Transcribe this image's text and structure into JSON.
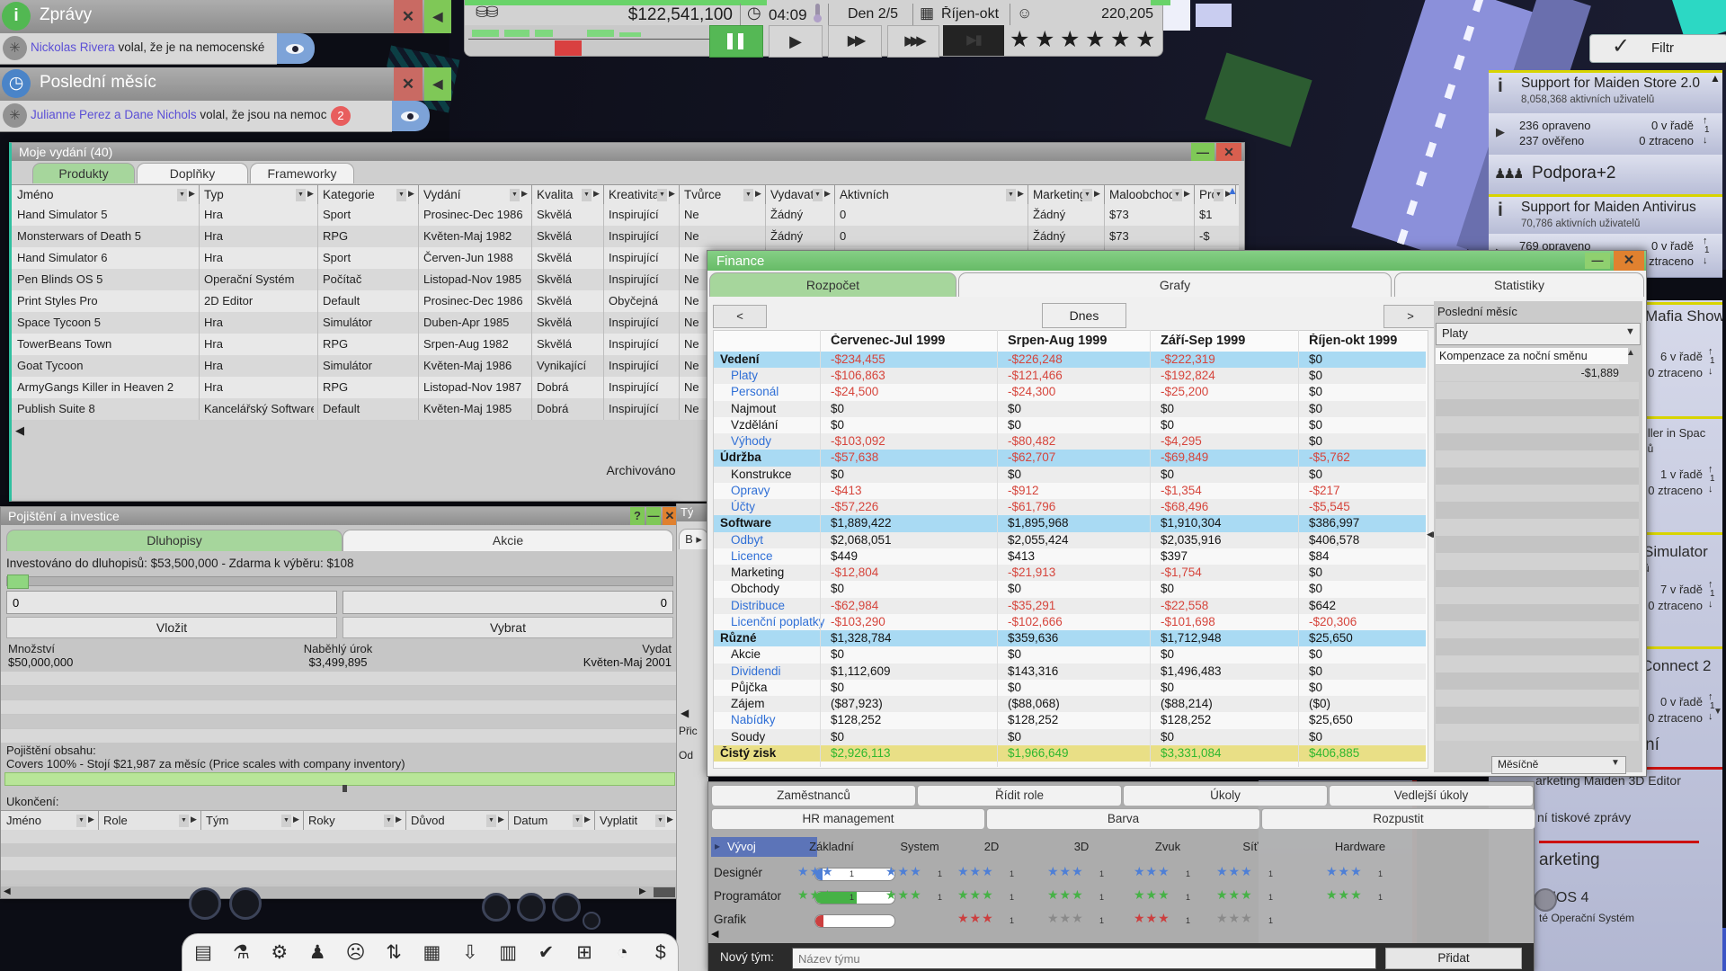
{
  "hud": {
    "money": "$122,541,100",
    "time": "04:09",
    "day": "Den 2/5",
    "month": "Říjen-okt",
    "fans": "220,205",
    "stars": 6,
    "accent_green": "#55b855",
    "accent_red": "#d94040"
  },
  "news": {
    "title": "Zprávy",
    "person": "Nickolas Rivera",
    "message": " volal, že je na nemocenské"
  },
  "last_month_popup": {
    "title": "Poslední měsíc",
    "persons": "Julianne Perez a Dane Nichols",
    "message": " volal, že jsou na nemocenské",
    "badge": "2"
  },
  "releases": {
    "title": "Moje vydání (40)",
    "tabs": [
      "Produkty",
      "Doplňky",
      "Frameworky"
    ],
    "active_tab": 0,
    "columns": [
      "Jméno",
      "Typ",
      "Kategorie",
      "Vydání",
      "Kvalita",
      "Kreativita",
      "Tvůrce",
      "Vydavatel",
      "Aktivních",
      "Marketing",
      "Maloobchod",
      "Pro"
    ],
    "rows": [
      [
        "Hand Simulator 5",
        "Hra",
        "Sport",
        "Prosinec-Dec 1986",
        "Skvělá",
        "Inspirující",
        "Ne",
        "Žádný",
        "0",
        "Žádný",
        "$73",
        "$1"
      ],
      [
        "Monsterwars of Death 5",
        "Hra",
        "RPG",
        "Květen-Maj 1982",
        "Skvělá",
        "Inspirující",
        "Ne",
        "Žádný",
        "0",
        "Žádný",
        "$73",
        "-$"
      ],
      [
        "Hand Simulator 6",
        "Hra",
        "Sport",
        "Červen-Jun 1988",
        "Skvělá",
        "Inspirující",
        "Ne",
        "",
        "",
        "",
        "",
        ""
      ],
      [
        "Pen Blinds OS 5",
        "Operační Systém",
        "Počítač",
        "Listopad-Nov 1985",
        "Skvělá",
        "Inspirující",
        "Ne",
        "",
        "",
        "",
        "",
        ""
      ],
      [
        "Print Styles Pro",
        "2D Editor",
        "Default",
        "Prosinec-Dec 1986",
        "Skvělá",
        "Obyčejná",
        "Ne",
        "",
        "",
        "",
        "",
        ""
      ],
      [
        "Space Tycoon 5",
        "Hra",
        "Simulátor",
        "Duben-Apr 1985",
        "Skvělá",
        "Inspirující",
        "Ne",
        "",
        "",
        "",
        "",
        ""
      ],
      [
        "TowerBeans Town",
        "Hra",
        "RPG",
        "Srpen-Aug 1982",
        "Skvělá",
        "Inspirující",
        "Ne",
        "",
        "",
        "",
        "",
        ""
      ],
      [
        "Goat Tycoon",
        "Hra",
        "Simulátor",
        "Květen-Maj 1986",
        "Vynikající",
        "Inspirující",
        "Ne",
        "",
        "",
        "",
        "",
        ""
      ],
      [
        "ArmyGangs Killer in Heaven 2",
        "Hra",
        "RPG",
        "Listopad-Nov 1987",
        "Dobrá",
        "Inspirující",
        "Ne",
        "",
        "",
        "",
        "",
        ""
      ],
      [
        "Publish Suite 8",
        "Kancelářský Software",
        "Default",
        "Květen-Maj 1985",
        "Dobrá",
        "Inspirující",
        "Ne",
        "",
        "",
        "",
        "",
        ""
      ]
    ],
    "footer": "Archivováno"
  },
  "finance": {
    "title": "Finance",
    "tabs": [
      "Rozpočet",
      "Grafy",
      "Statistiky"
    ],
    "active_tab": 0,
    "prev": "<",
    "today": "Dnes",
    "next": ">",
    "months": [
      "Červenec-Jul 1999",
      "Srpen-Aug 1999",
      "Září-Sep 1999",
      "Říjen-okt 1999"
    ],
    "rows": [
      [
        "Vedení",
        "-$234,455",
        "-$226,248",
        "-$222,319",
        "$0",
        "section"
      ],
      [
        "Platy",
        "-$106,863",
        "-$121,466",
        "-$192,824",
        "$0",
        "link"
      ],
      [
        "Personál",
        "-$24,500",
        "-$24,300",
        "-$25,200",
        "$0",
        "link"
      ],
      [
        "Najmout",
        "$0",
        "$0",
        "$0",
        "$0",
        "plain"
      ],
      [
        "Vzdělání",
        "$0",
        "$0",
        "$0",
        "$0",
        "plain"
      ],
      [
        "Výhody",
        "-$103,092",
        "-$80,482",
        "-$4,295",
        "$0",
        "link"
      ],
      [
        "Údržba",
        "-$57,638",
        "-$62,707",
        "-$69,849",
        "-$5,762",
        "section"
      ],
      [
        "Konstrukce",
        "$0",
        "$0",
        "$0",
        "$0",
        "plain"
      ],
      [
        "Opravy",
        "-$413",
        "-$912",
        "-$1,354",
        "-$217",
        "link"
      ],
      [
        "Účty",
        "-$57,226",
        "-$61,796",
        "-$68,496",
        "-$5,545",
        "link"
      ],
      [
        "Software",
        "$1,889,422",
        "$1,895,968",
        "$1,910,304",
        "$386,997",
        "section"
      ],
      [
        "Odbyt",
        "$2,068,051",
        "$2,055,424",
        "$2,035,916",
        "$406,578",
        "link"
      ],
      [
        "Licence",
        "$449",
        "$413",
        "$397",
        "$84",
        "link"
      ],
      [
        "Marketing",
        "-$12,804",
        "-$21,913",
        "-$1,754",
        "$0",
        "plain"
      ],
      [
        "Obchody",
        "$0",
        "$0",
        "$0",
        "$0",
        "plain"
      ],
      [
        "Distribuce",
        "-$62,984",
        "-$35,291",
        "-$22,558",
        "$642",
        "link"
      ],
      [
        "Licenční poplatky",
        "-$103,290",
        "-$102,666",
        "-$101,698",
        "-$20,306",
        "link"
      ],
      [
        "Různé",
        "$1,328,784",
        "$359,636",
        "$1,712,948",
        "$25,650",
        "section"
      ],
      [
        "Akcie",
        "$0",
        "$0",
        "$0",
        "$0",
        "plain"
      ],
      [
        "Dividendi",
        "$1,112,609",
        "$143,316",
        "$1,496,483",
        "$0",
        "link"
      ],
      [
        "Půjčka",
        "$0",
        "$0",
        "$0",
        "$0",
        "plain"
      ],
      [
        "Zájem",
        "($87,923)",
        "($88,068)",
        "($88,214)",
        "($0)",
        "plain"
      ],
      [
        "Nabídky",
        "$128,252",
        "$128,252",
        "$128,252",
        "$25,650",
        "link"
      ],
      [
        "Soudy",
        "$0",
        "$0",
        "$0",
        "$0",
        "plain"
      ],
      [
        "Čistý zisk",
        "$2,926,113",
        "$1,966,649",
        "$3,331,084",
        "$406,885",
        "net"
      ]
    ],
    "side": {
      "header": "Poslední měsíc",
      "dropdown": "Platy",
      "entry": "Kompenzace za noční směnu",
      "entry_value": "-$1,889",
      "period_dropdown": "Měsíčně"
    },
    "colors": {
      "negative": "#d6453c",
      "positive_net": "#2eb82e",
      "link": "#2f6fd6",
      "section_bg": "#a9daf3",
      "net_bg": "#e9df86"
    }
  },
  "insurance": {
    "title": "Pojištění a investice",
    "tabs": [
      "Dluhopisy",
      "Akcie"
    ],
    "active_tab": 0,
    "invested_line": "Investováno do dluhopisů: $53,500,000 - Zdarma k výběru: $108",
    "deposit_value": "0",
    "withdraw_value": "0",
    "deposit_btn": "Vložit",
    "withdraw_btn": "Vybrat",
    "amount_label": "Množství",
    "amount_value": "$50,000,000",
    "interest_label": "Naběhlý úrok",
    "interest_value": "$3,499,895",
    "issue_label": "Vydat",
    "issue_value": "Květen-Maj 2001",
    "content_label": "Pojištění obsahu:",
    "content_desc": "Covers 100% - Stojí $21,987 za měsíc (Price scales with company inventory)",
    "termination_label": "Ukončení:",
    "columns": [
      "Jméno",
      "Role",
      "Tým",
      "Roky",
      "Důvod",
      "Datum",
      "Vyplatit"
    ]
  },
  "team_sliver": {
    "title": "Tý",
    "tab": "B",
    "label1": "Přic",
    "label2": "Od"
  },
  "team": {
    "tabs_row1": [
      "Zaměstnanců",
      "Řídit role",
      "Úkoly",
      "Vedlejší úkoly"
    ],
    "tabs_row2": [
      "HR management",
      "Barva",
      "Rozpustit"
    ],
    "dev_header": "Vývoj",
    "skill_columns": [
      "Základní",
      "System",
      "2D",
      "3D",
      "Zvuk",
      "Síť",
      "Hardware"
    ],
    "star_colors": {
      "b": "#4e7fd6",
      "g": "#46b246",
      "r": "#cc3f3f",
      "x": "#8a8a8a"
    },
    "roles": [
      {
        "name": "Designér",
        "pill": "#4e7fd6",
        "fill": 0.06,
        "stars": [
          "b",
          "b",
          "b",
          "b",
          "b",
          "b",
          "b"
        ]
      },
      {
        "name": "Programátor",
        "pill": "#46b246",
        "fill": 0.52,
        "stars": [
          "g",
          "g",
          "g",
          "g",
          "g",
          "g",
          "g"
        ]
      },
      {
        "name": "Grafik",
        "pill": "#cc3f3f",
        "fill": 0.1,
        "stars": [
          "",
          "",
          "r",
          "x",
          "r",
          "x",
          ""
        ]
      }
    ],
    "new_team_label": "Nový tým:",
    "new_team_placeholder": "Název týmu",
    "add_btn": "Přidat"
  },
  "notifications": {
    "filter": "Filtr",
    "cards": [
      {
        "kind": "info",
        "title": "Support for Maiden Store 2.0",
        "sub": "8,058,368 aktivních uživatelů"
      },
      {
        "kind": "stat",
        "l1": "236 opraveno",
        "l2": "237 ověřeno",
        "r1": "0 v řadě",
        "r2": "0 ztraceno",
        "n": "1"
      },
      {
        "kind": "group",
        "title": "Podpora+2"
      },
      {
        "kind": "info",
        "title": "Support for Maiden Antivirus",
        "sub": "70,786 aktivních uživatelů"
      },
      {
        "kind": "stat",
        "l1": "769 opraveno",
        "l2": "",
        "r1": "0 v řadě",
        "r2": "0 ztraceno",
        "n": "1"
      }
    ],
    "fragments": [
      "Mafia Show",
      "6 v řadě",
      "0 ztraceno",
      "iller in Spac",
      "lů",
      "1 v řadě",
      "0 ztraceno",
      "Simulator",
      "ů",
      "7 v řadě",
      "0 ztraceno",
      "Connect 2",
      "ů",
      "0 v řadě",
      "0 ztraceno",
      "ní",
      "arketing Maiden 3D Editor",
      "ní tiskové zprávy",
      "arketing",
      "dOS 4",
      "té Operační Systém"
    ]
  },
  "toolbar": {
    "icons": [
      {
        "name": "document-icon",
        "glyph": "▤"
      },
      {
        "name": "research-flask-icon",
        "glyph": "⚗"
      },
      {
        "name": "settings-gear-icon",
        "glyph": "⚙"
      },
      {
        "name": "staff-icon",
        "glyph": "♟"
      },
      {
        "name": "mood-icon",
        "glyph": "☹"
      },
      {
        "name": "stocks-icon",
        "glyph": "⇅"
      },
      {
        "name": "inventory-box-icon",
        "glyph": "▦"
      },
      {
        "name": "shipping-icon",
        "glyph": "⇩"
      },
      {
        "name": "reports-icon",
        "glyph": "▥"
      },
      {
        "name": "deals-check-icon",
        "glyph": "✔"
      },
      {
        "name": "calendar-grid-icon",
        "glyph": "⊞"
      },
      {
        "name": "pie-chart-icon",
        "glyph": "◔"
      },
      {
        "name": "money-icon",
        "glyph": "$"
      }
    ]
  }
}
